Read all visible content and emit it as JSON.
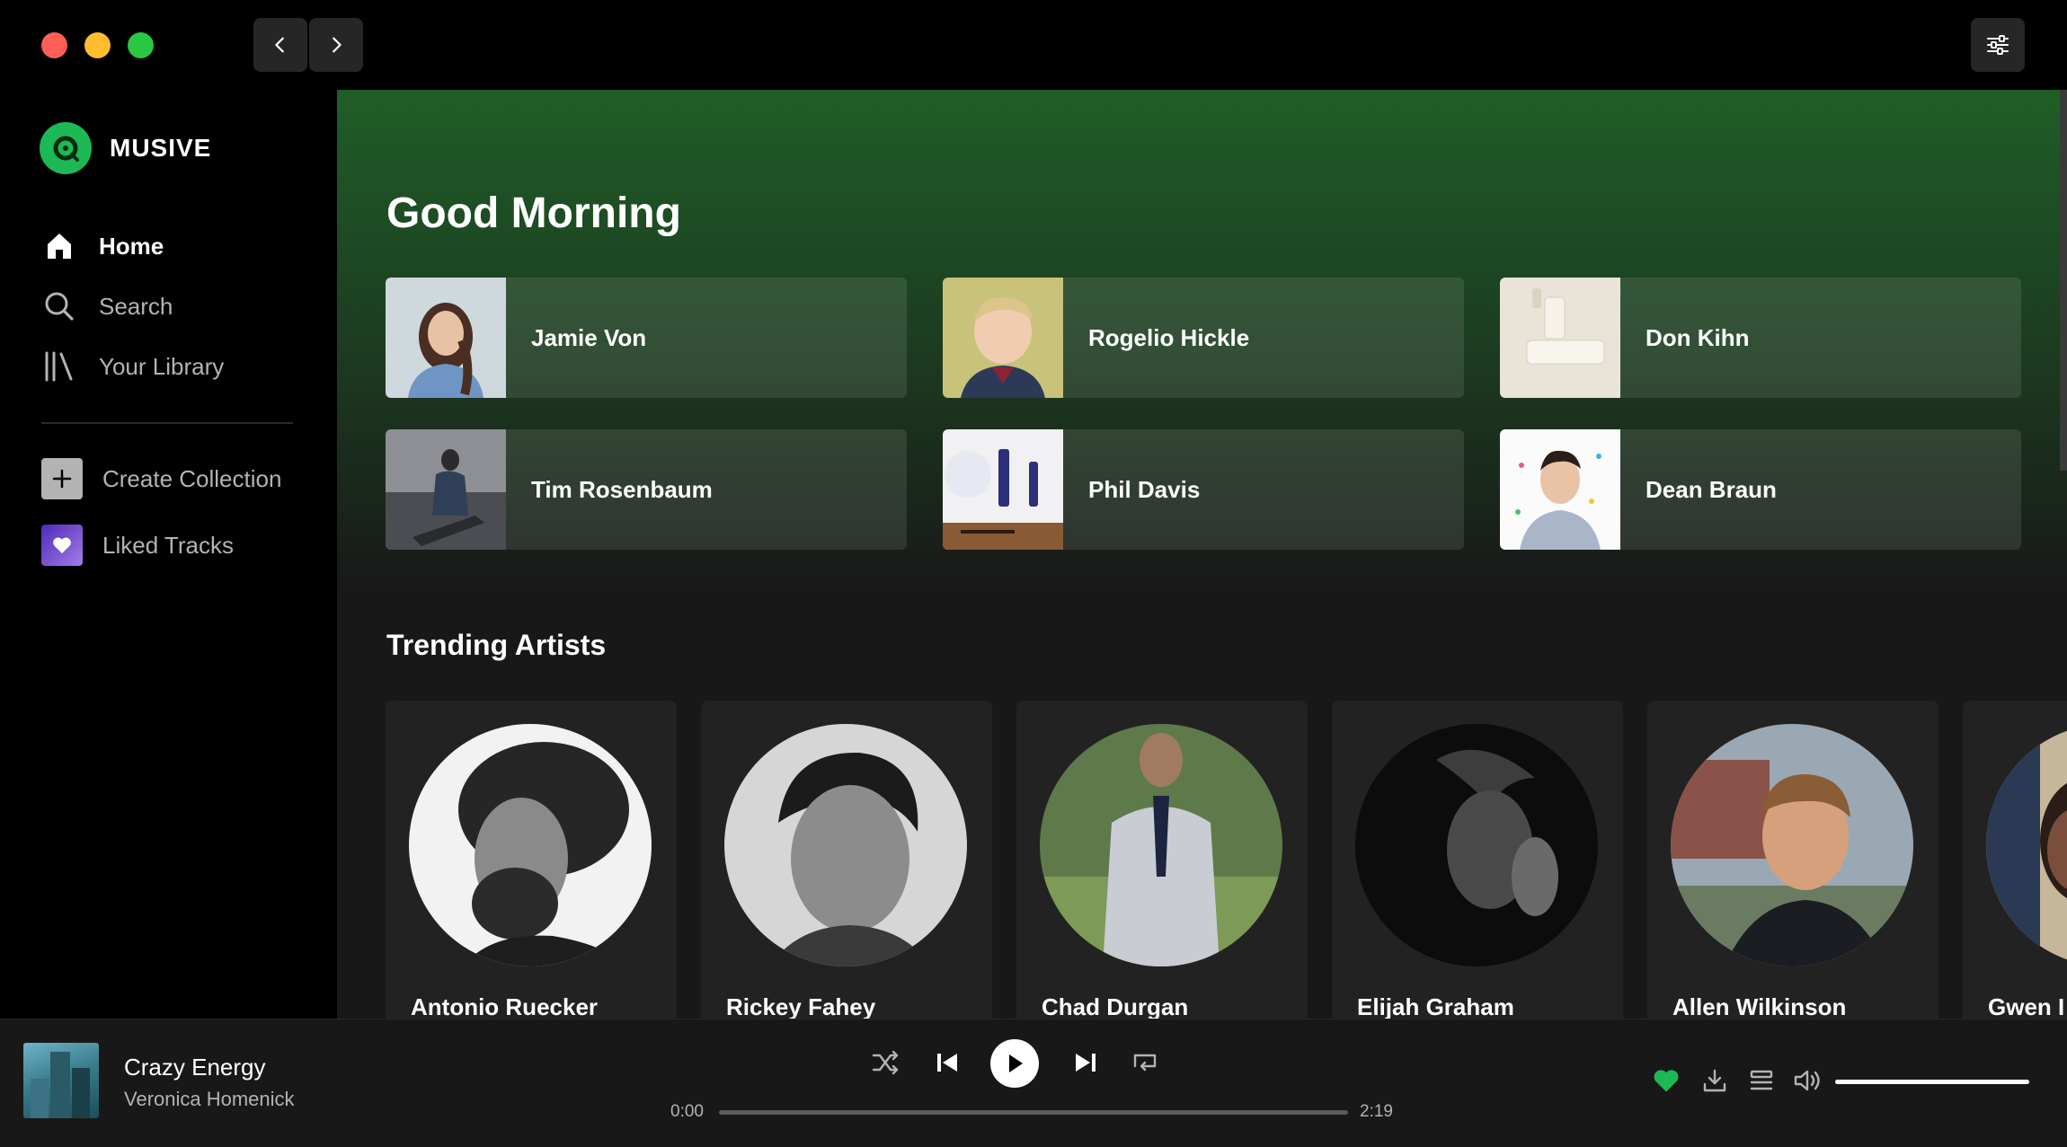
{
  "app": {
    "name": "MUSIVE",
    "accent_color": "#1db954"
  },
  "sidebar": {
    "nav": [
      {
        "label": "Home",
        "icon": "home-icon",
        "active": true
      },
      {
        "label": "Search",
        "icon": "search-icon",
        "active": false
      },
      {
        "label": "Your Library",
        "icon": "library-icon",
        "active": false
      }
    ],
    "actions": [
      {
        "label": "Create Collection",
        "icon": "plus-icon"
      },
      {
        "label": "Liked Tracks",
        "icon": "heart-icon"
      }
    ]
  },
  "main": {
    "greeting": "Good Morning",
    "quick_picks": [
      {
        "name": "Jamie Von"
      },
      {
        "name": "Rogelio Hickle"
      },
      {
        "name": "Don Kihn"
      },
      {
        "name": "Tim Rosenbaum"
      },
      {
        "name": "Phil Davis"
      },
      {
        "name": "Dean Braun"
      }
    ],
    "trending_title": "Trending Artists",
    "artists": [
      {
        "name": "Antonio Ruecker"
      },
      {
        "name": "Rickey Fahey"
      },
      {
        "name": "Chad Durgan"
      },
      {
        "name": "Elijah Graham"
      },
      {
        "name": "Allen Wilkinson"
      },
      {
        "name": "Gwen I"
      }
    ]
  },
  "player": {
    "track_title": "Crazy Energy",
    "track_artist": "Veronica Homenick",
    "time_elapsed": "0:00",
    "time_total": "2:19",
    "progress_fraction": 0.0,
    "volume_fraction": 1.0,
    "liked": true
  }
}
